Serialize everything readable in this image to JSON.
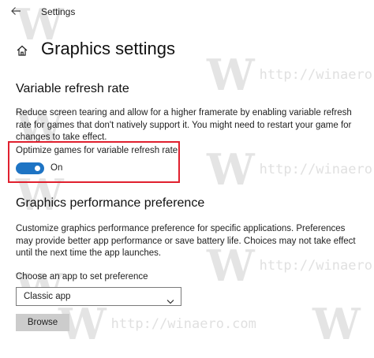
{
  "window": {
    "app_title": "Settings"
  },
  "header": {
    "page_title": "Graphics settings"
  },
  "variable_refresh": {
    "section_title": "Variable refresh rate",
    "description": "Reduce screen tearing and allow for a higher framerate by enabling variable refresh rate for games that don't natively support it. You might need to restart your game for changes to take effect.",
    "toggle_label": "Optimize games for variable refresh rate",
    "toggle_state": "On",
    "toggle_on": true
  },
  "performance_preference": {
    "section_title": "Graphics performance preference",
    "description": "Customize graphics performance preference for specific applications. Preferences may provide better app performance or save battery life. Choices may not take effect until the next time the app launches.",
    "choose_label": "Choose an app to set preference",
    "select_value": "Classic app",
    "browse_label": "Browse"
  },
  "watermark": {
    "letter": "W",
    "url": "http://winaero.com"
  },
  "icons": {
    "back": "back-arrow-icon",
    "home": "home-icon",
    "dropdown": "chevron-down-icon"
  },
  "colors": {
    "accent": "#1e74c4",
    "highlight_border": "#e0202e",
    "button_bg": "#cccccc"
  }
}
